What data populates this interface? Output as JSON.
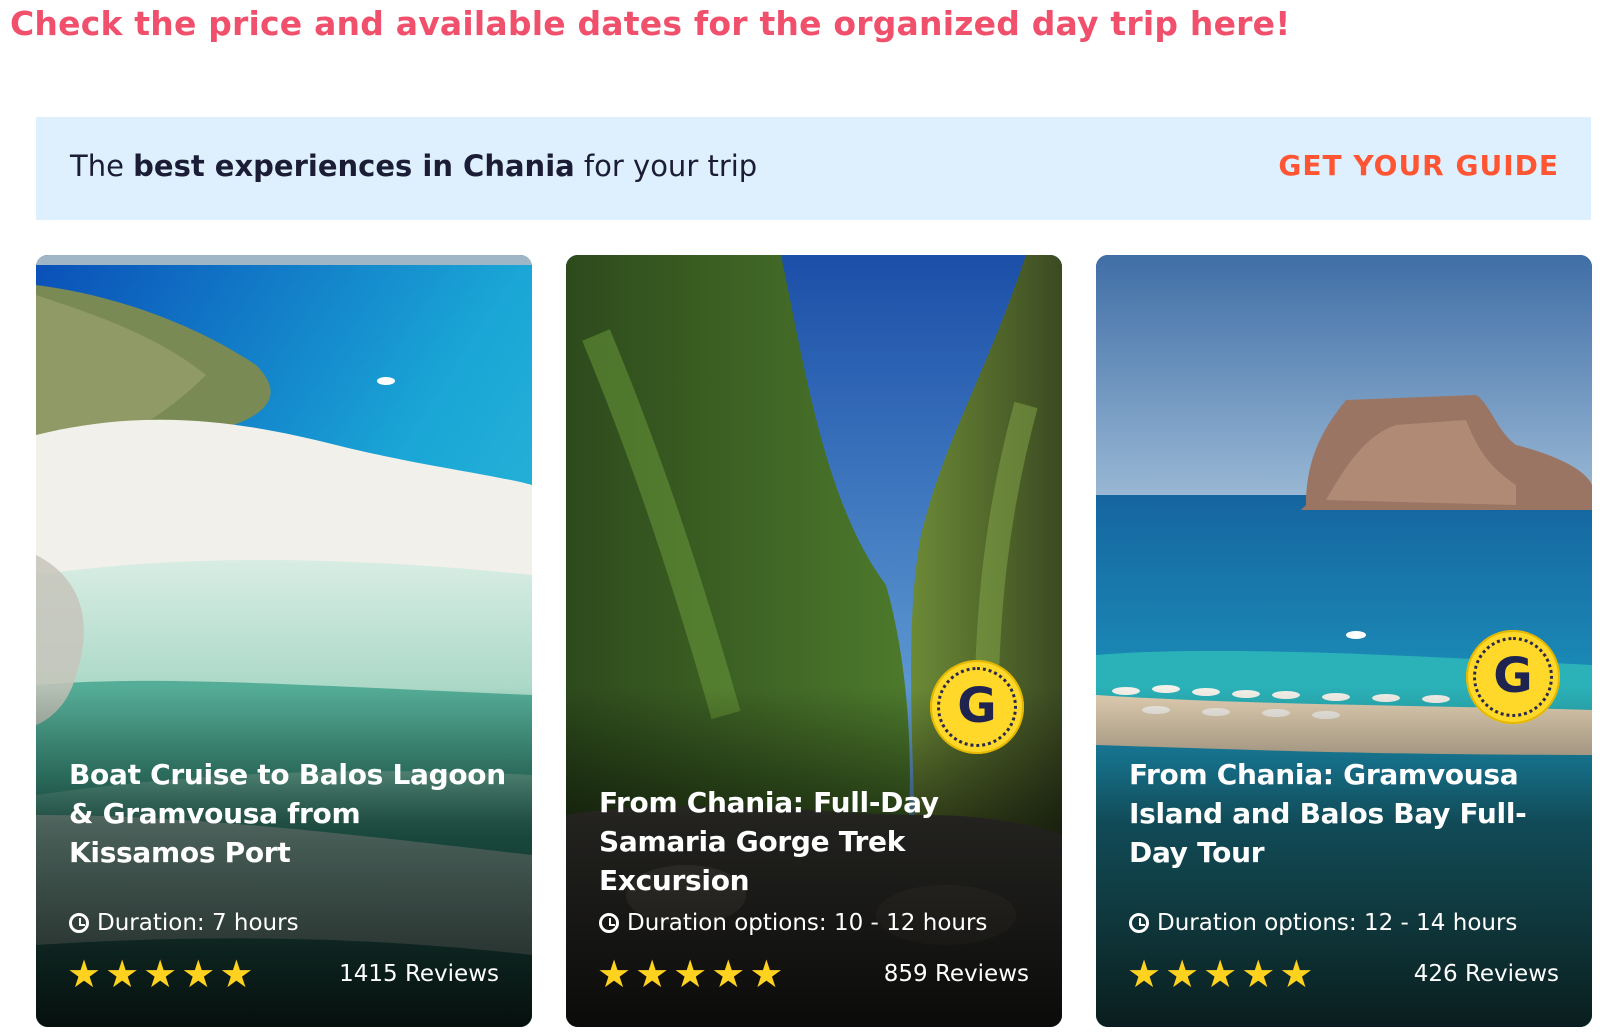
{
  "headline": "Check the price and available dates for the organized day trip here!",
  "banner": {
    "prefix": "The ",
    "highlight": "best experiences in Chania",
    "suffix": " for your trip",
    "logo": "GET YOUR GUIDE"
  },
  "colors": {
    "headline": "#f0506b",
    "banner_bg": "#deeffd",
    "logo": "#ff5533",
    "stars": "#ffd21f",
    "badge": "#ffd82a"
  },
  "cards": [
    {
      "title": "Boat Cruise to Balos Lagoon & Gramvousa from Kissamos Port",
      "duration": "Duration: 7 hours",
      "rating": 5,
      "reviews": "1415 Reviews",
      "badge": false
    },
    {
      "title": "From Chania: Full-Day Samaria Gorge Trek Excursion",
      "duration": "Duration options: 10 - 12 hours",
      "rating": 5,
      "reviews": "859 Reviews",
      "badge": true,
      "badge_letter": "G"
    },
    {
      "title": "From Chania: Gramvousa Island and Balos Bay Full-Day Tour",
      "duration": "Duration options: 12 - 14 hours",
      "rating": 5,
      "reviews": "426 Reviews",
      "badge": true,
      "badge_letter": "G"
    }
  ]
}
